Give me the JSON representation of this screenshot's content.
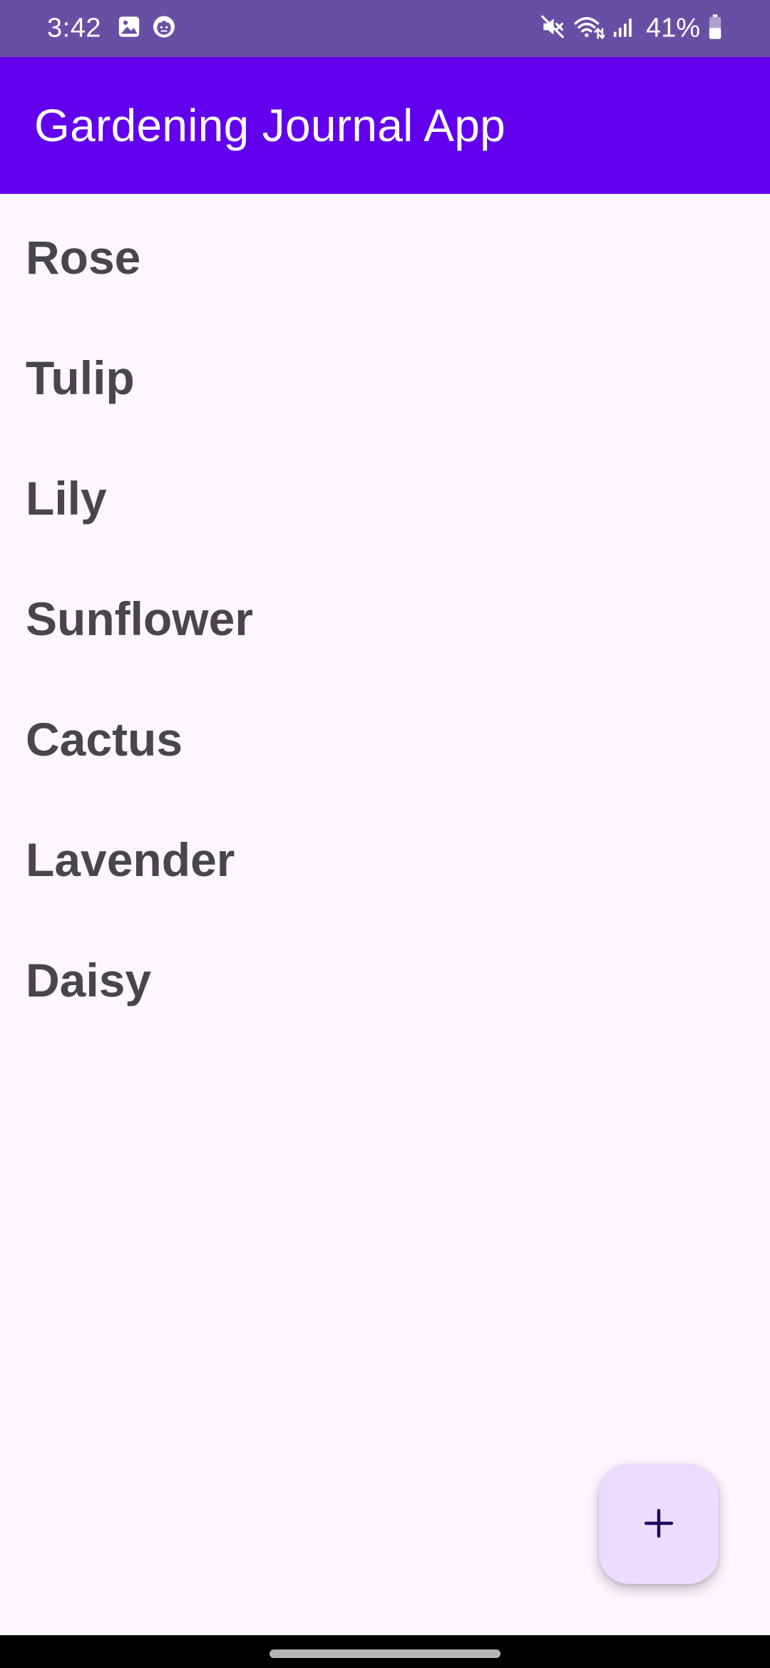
{
  "status_bar": {
    "time": "3:42",
    "battery": "41%",
    "left_icons": [
      "image-icon",
      "notification-face-icon"
    ],
    "right_icons": [
      "mute-icon",
      "wifi-icon",
      "signal-icon",
      "battery-icon"
    ]
  },
  "app_bar": {
    "title": "Gardening Journal App",
    "color": "#6200ee"
  },
  "plants": [
    {
      "name": "Rose"
    },
    {
      "name": "Tulip"
    },
    {
      "name": "Lily"
    },
    {
      "name": "Sunflower"
    },
    {
      "name": "Cactus"
    },
    {
      "name": "Lavender"
    },
    {
      "name": "Daisy"
    }
  ],
  "fab": {
    "icon": "plus-icon",
    "color": "#eaddff"
  }
}
